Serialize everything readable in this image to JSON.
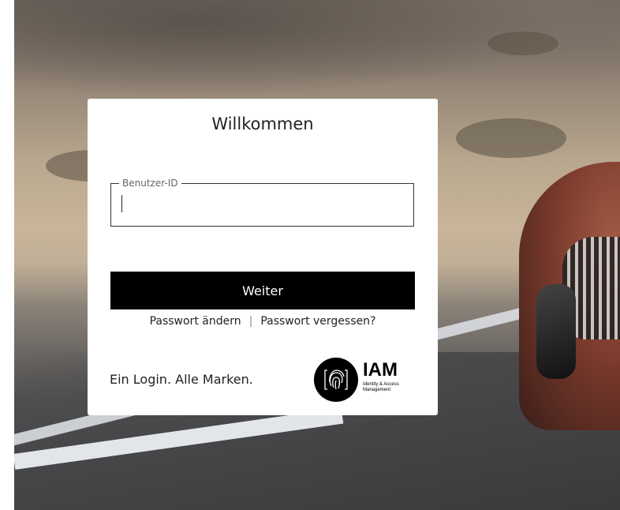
{
  "card": {
    "title": "Willkommen",
    "user_field": {
      "label": "Benutzer-ID",
      "value": "",
      "placeholder": ""
    },
    "continue_label": "Weiter",
    "links": {
      "change_password": "Passwort ändern",
      "separator": "|",
      "forgot_password": "Passwort vergessen?"
    },
    "tagline": "Ein Login. Alle Marken.",
    "logo": {
      "icon": "fingerprint-icon",
      "brand": "IAM",
      "subtitle_line1": "Identity & Access",
      "subtitle_line2": "Management"
    }
  }
}
